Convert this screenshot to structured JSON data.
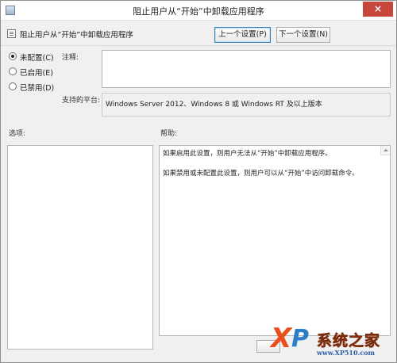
{
  "window": {
    "title": "阻止用户从“开始”中卸载应用程序",
    "close_symbol": "×"
  },
  "header": {
    "policy_name": "阻止用户从“开始”中卸载应用程序",
    "prev_button": "上一个设置(P)",
    "next_button": "下一个设置(N)"
  },
  "state": {
    "options": [
      {
        "label": "未配置(C)",
        "checked": true
      },
      {
        "label": "已启用(E)",
        "checked": false
      },
      {
        "label": "已禁用(D)",
        "checked": false
      }
    ]
  },
  "labels": {
    "comment": "注释:",
    "platform": "支持的平台:",
    "options": "选项:",
    "help": "帮助:"
  },
  "platform_value": "Windows Server 2012、Windows 8 或 Windows RT 及以上版本",
  "help": {
    "paragraphs": [
      "如果启用此设置，则用户无法从“开始”中卸载应用程序。",
      "如果禁用或未配置此设置，则用户可以从“开始”中访问卸载命令。"
    ]
  },
  "watermark": {
    "logo_x": "X",
    "logo_p": "P",
    "brand": "系统之家",
    "url": "www.XP510.com"
  },
  "colors": {
    "close_button": "#c7463c",
    "watermark_orange": "#f25a12",
    "watermark_blue": "#2c7ec9"
  },
  "icons": [
    "app-icon",
    "policy-setting-icon",
    "close-icon",
    "scroll-up-arrow-icon"
  ]
}
